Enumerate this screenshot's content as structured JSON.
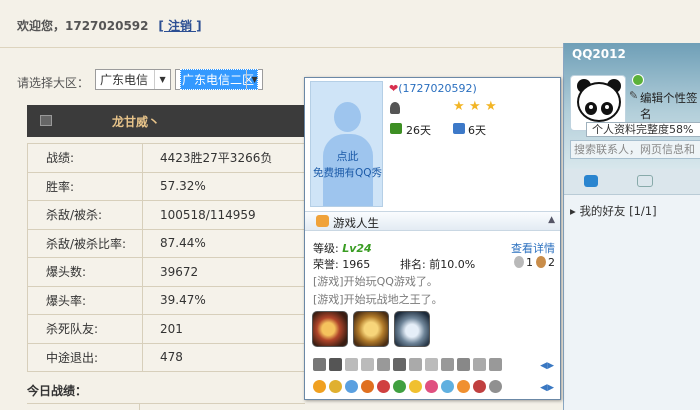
{
  "page": {
    "welcome": "欢迎您，1727020592",
    "logout_label": "[ 注销 ]",
    "region_label": "请选择大区：",
    "region_select_1": "广东电信",
    "region_select_2": "广东电信二区",
    "player_name": "龙甘威丶",
    "stats": [
      {
        "label": "战绩:",
        "value": "4423胜27平3266负"
      },
      {
        "label": "胜率:",
        "value": "57.32%"
      },
      {
        "label": "杀敌/被杀:",
        "value": "100518/114959"
      },
      {
        "label": "杀敌/被杀比率:",
        "value": "87.44%"
      },
      {
        "label": "爆头数:",
        "value": "39672"
      },
      {
        "label": "爆头率:",
        "value": "39.47%"
      },
      {
        "label": "杀死队友:",
        "value": "201"
      },
      {
        "label": "中途退出:",
        "value": "478"
      }
    ],
    "today_label": "今日战绩："
  },
  "qq_panel": {
    "title": "QQ2012",
    "mood": "编辑个性签名",
    "profile_tip": "个人资料完整度58%",
    "search_placeholder": "搜索联系人，网页信息和",
    "group_label": "我的好友",
    "group_count": "[1/1]"
  },
  "profile_popup": {
    "heart_icon": "heart-icon",
    "qq_number": "(1727020592)",
    "photo_line1": "点此",
    "photo_line2": "免费拥有QQ秀",
    "days_1": "26天",
    "days_2": "6天",
    "game_section_title": "游戏人生",
    "level_label": "等级:",
    "level_value": "Lv24",
    "detail_link": "查看详情",
    "honor_label": "荣誉:",
    "honor_value": "1965",
    "rank_label": "排名:",
    "rank_value": "前10.0%",
    "medal_1_count": "1",
    "medal_2_count": "2",
    "log_1": "[游戏]开始玩QQ游戏了。",
    "log_2": "[游戏]开始玩战地之王了。"
  }
}
